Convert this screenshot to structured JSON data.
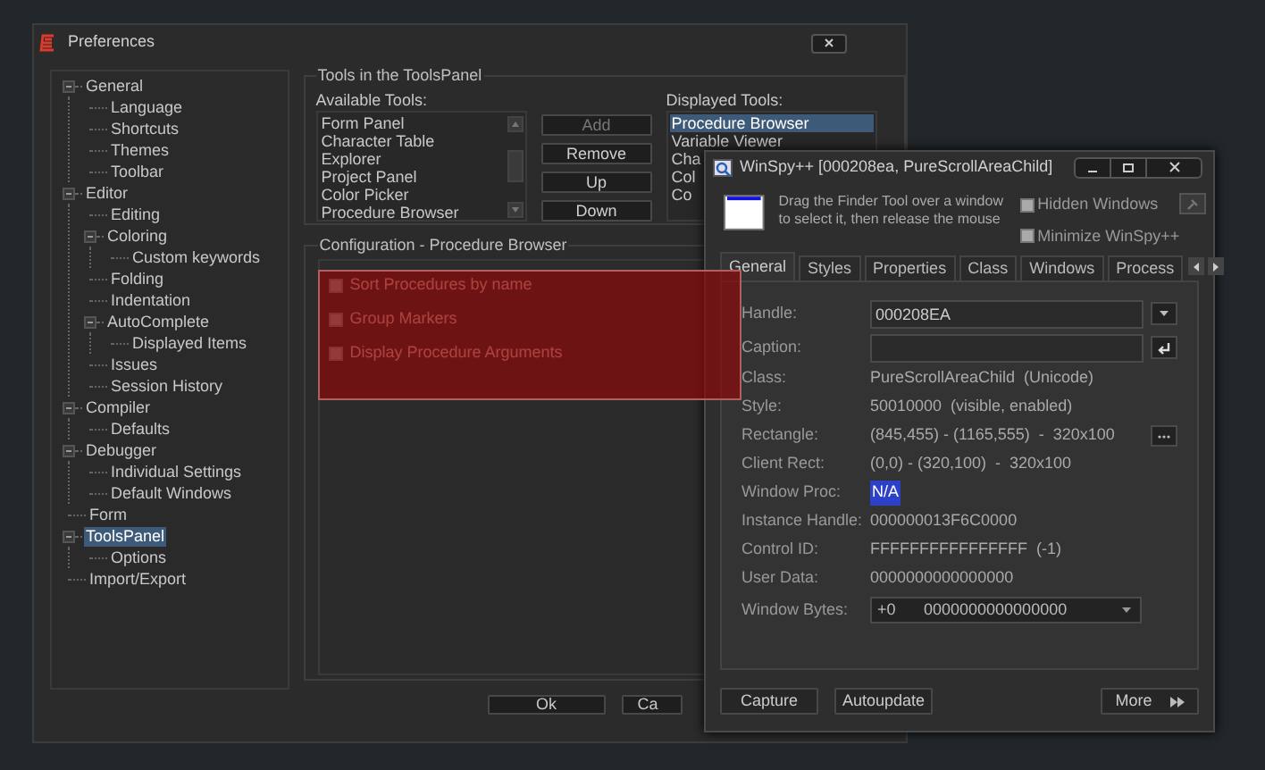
{
  "preferences": {
    "title": "Preferences",
    "tree": [
      {
        "label": "General",
        "expanded": true,
        "selected": false,
        "children": [
          {
            "label": "Language",
            "selected": false
          },
          {
            "label": "Shortcuts",
            "selected": false
          },
          {
            "label": "Themes",
            "selected": false
          },
          {
            "label": "Toolbar",
            "selected": false
          }
        ]
      },
      {
        "label": "Editor",
        "expanded": true,
        "selected": false,
        "children": [
          {
            "label": "Editing",
            "selected": false
          },
          {
            "label": "Coloring",
            "expanded": true,
            "selected": false,
            "children": [
              {
                "label": "Custom keywords",
                "selected": false
              }
            ]
          },
          {
            "label": "Folding",
            "selected": false
          },
          {
            "label": "Indentation",
            "selected": false
          },
          {
            "label": "AutoComplete",
            "expanded": true,
            "selected": false,
            "children": [
              {
                "label": "Displayed Items",
                "selected": false
              }
            ]
          },
          {
            "label": "Issues",
            "selected": false
          },
          {
            "label": "Session History",
            "selected": false
          }
        ]
      },
      {
        "label": "Compiler",
        "expanded": true,
        "selected": false,
        "children": [
          {
            "label": "Defaults",
            "selected": false
          }
        ]
      },
      {
        "label": "Debugger",
        "expanded": true,
        "selected": false,
        "children": [
          {
            "label": "Individual Settings",
            "selected": false
          },
          {
            "label": "Default Windows",
            "selected": false
          }
        ]
      },
      {
        "label": "Form",
        "selected": false
      },
      {
        "label": "ToolsPanel",
        "expanded": true,
        "selected": true,
        "children": [
          {
            "label": "Options",
            "selected": false
          }
        ]
      },
      {
        "label": "Import/Export",
        "selected": false
      }
    ],
    "tools_group": {
      "title": "Tools in the ToolsPanel",
      "available_label": "Available Tools:",
      "available_tools": [
        "Form Panel",
        "Character Table",
        "Explorer",
        "Project Panel",
        "Color Picker",
        "Procedure Browser"
      ],
      "buttons": [
        {
          "label": "Add",
          "disabled": true
        },
        {
          "label": "Remove",
          "disabled": false
        },
        {
          "label": "Up",
          "disabled": false
        },
        {
          "label": "Down",
          "disabled": false
        }
      ],
      "displayed_label": "Displayed Tools:",
      "displayed_tools": [
        {
          "label": "Procedure Browser",
          "selected": true
        },
        {
          "label": "Variable Viewer",
          "selected": false
        },
        {
          "label": "Cha",
          "selected": false
        },
        {
          "label": "Col",
          "selected": false
        },
        {
          "label": "Co",
          "selected": false
        }
      ]
    },
    "config_group": {
      "title": "Configuration - Procedure Browser",
      "options": [
        {
          "label": "Sort Procedures by name",
          "checked": false
        },
        {
          "label": "Group Markers",
          "checked": false
        },
        {
          "label": "Display Procedure Arguments",
          "checked": false
        }
      ]
    },
    "buttons": [
      "Ok",
      "Ca"
    ]
  },
  "winspy": {
    "title": "WinSpy++ [000208ea, PureScrollAreaChild]",
    "finder_hint": [
      "Drag the Finder Tool over a window",
      "to select it, then release the mouse"
    ],
    "options": [
      {
        "label": "Hidden Windows",
        "checked": false
      },
      {
        "label": "Minimize WinSpy++",
        "checked": false
      }
    ],
    "tabs": [
      {
        "label": "General",
        "selected": true
      },
      {
        "label": "Styles",
        "selected": false
      },
      {
        "label": "Properties",
        "selected": false
      },
      {
        "label": "Class",
        "selected": false
      },
      {
        "label": "Windows",
        "selected": false
      },
      {
        "label": "Process",
        "selected": false
      }
    ],
    "fields": [
      {
        "kind": "input",
        "label": "Handle:",
        "value": "000208EA"
      },
      {
        "kind": "input",
        "label": "Caption:"
      },
      {
        "kind": "text",
        "label": "Class:",
        "value": "PureScrollAreaChild  (Unicode)"
      },
      {
        "kind": "text",
        "label": "Style:",
        "value": "50010000  (visible, enabled)"
      },
      {
        "kind": "text",
        "label": "Rectangle:",
        "value": "(845,455) - (1165,555)  -  320x100"
      },
      {
        "kind": "text",
        "label": "Client Rect:",
        "value": "(0,0) - (320,100)  -  320x100"
      },
      {
        "kind": "link",
        "label": "Window Proc:",
        "value": "N/A"
      },
      {
        "kind": "text",
        "label": "Instance Handle:",
        "value": "000000013F6C0000"
      },
      {
        "kind": "text",
        "label": "Control ID:",
        "value": "FFFFFFFFFFFFFFFF  (-1)"
      },
      {
        "kind": "text",
        "label": "User Data:",
        "value": "0000000000000000"
      },
      {
        "kind": "dropdown",
        "label": "Window Bytes:",
        "value": "+0",
        "value_2": "0000000000000000"
      }
    ],
    "buttons": [
      "Capture",
      "Autoupdate",
      "More"
    ]
  }
}
